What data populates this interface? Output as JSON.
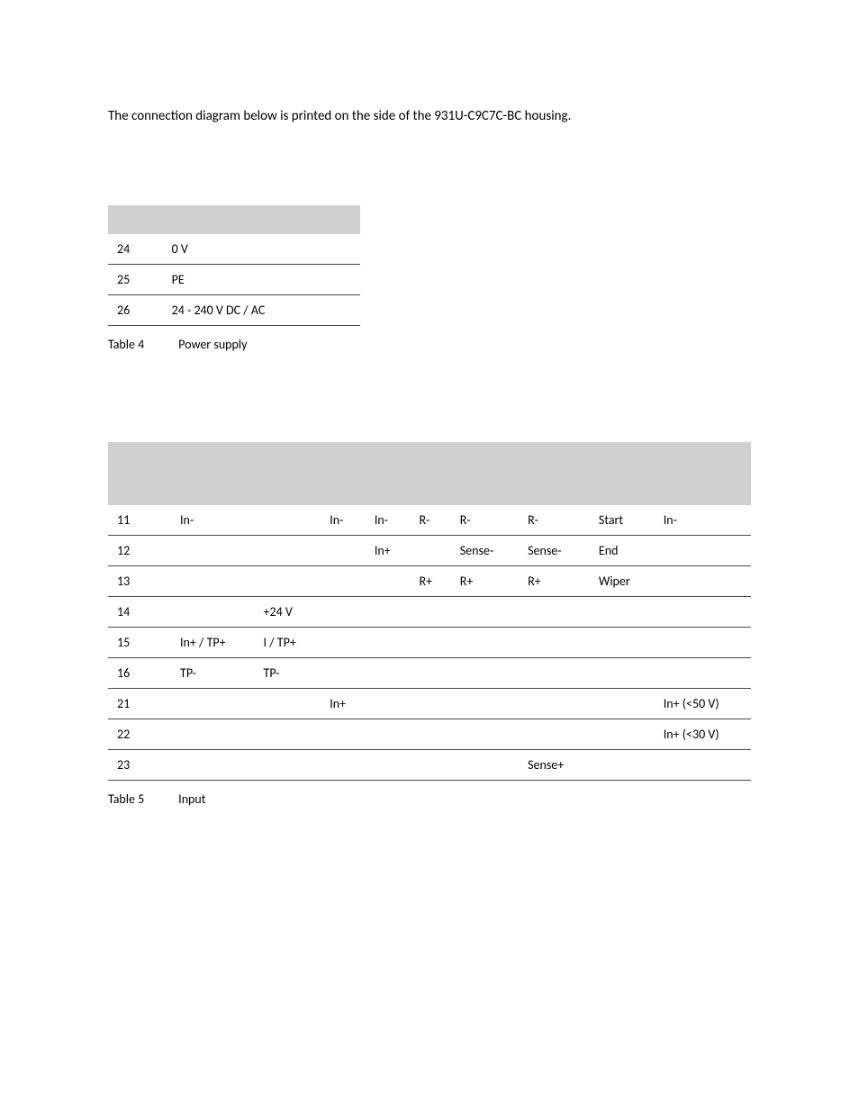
{
  "intro": "The connection diagram below is printed on the side of the 931U-C9C7C-BC housing.",
  "table4": {
    "rows": [
      {
        "c0": "24",
        "c1": "0 V"
      },
      {
        "c0": "25",
        "c1": "PE"
      },
      {
        "c0": "26",
        "c1": "24 - 240 V DC / AC"
      }
    ],
    "caption_label": "Table 4",
    "caption_text": "Power supply"
  },
  "table5": {
    "rows": [
      {
        "c0": "11",
        "c1": "In-",
        "c2": "",
        "c3": "In-",
        "c4": "In-",
        "c5": "R-",
        "c6": "R-",
        "c7": "R-",
        "c8": "Start",
        "c9": "In-"
      },
      {
        "c0": "12",
        "c1": "",
        "c2": "",
        "c3": "",
        "c4": "In+",
        "c5": "",
        "c6": "Sense-",
        "c7": "Sense-",
        "c8": "End",
        "c9": ""
      },
      {
        "c0": "13",
        "c1": "",
        "c2": "",
        "c3": "",
        "c4": "",
        "c5": "R+",
        "c6": "R+",
        "c7": "R+",
        "c8": "Wiper",
        "c9": ""
      },
      {
        "c0": "14",
        "c1": "",
        "c2": "+24 V",
        "c3": "",
        "c4": "",
        "c5": "",
        "c6": "",
        "c7": "",
        "c8": "",
        "c9": ""
      },
      {
        "c0": "15",
        "c1": "In+ / TP+",
        "c2": "I     / TP+",
        "c3": "",
        "c4": "",
        "c5": "",
        "c6": "",
        "c7": "",
        "c8": "",
        "c9": ""
      },
      {
        "c0": "16",
        "c1": "TP-",
        "c2": "TP-",
        "c3": "",
        "c4": "",
        "c5": "",
        "c6": "",
        "c7": "",
        "c8": "",
        "c9": ""
      },
      {
        "c0": "21",
        "c1": "",
        "c2": "",
        "c3": "In+",
        "c4": "",
        "c5": "",
        "c6": "",
        "c7": "",
        "c8": "",
        "c9": "In+ (<50 V)"
      },
      {
        "c0": "22",
        "c1": "",
        "c2": "",
        "c3": "",
        "c4": "",
        "c5": "",
        "c6": "",
        "c7": "",
        "c8": "",
        "c9": "In+ (<30 V)"
      },
      {
        "c0": "23",
        "c1": "",
        "c2": "",
        "c3": "",
        "c4": "",
        "c5": "",
        "c6": "",
        "c7": "Sense+",
        "c8": "",
        "c9": ""
      }
    ],
    "caption_label": "Table 5",
    "caption_text": "Input"
  }
}
